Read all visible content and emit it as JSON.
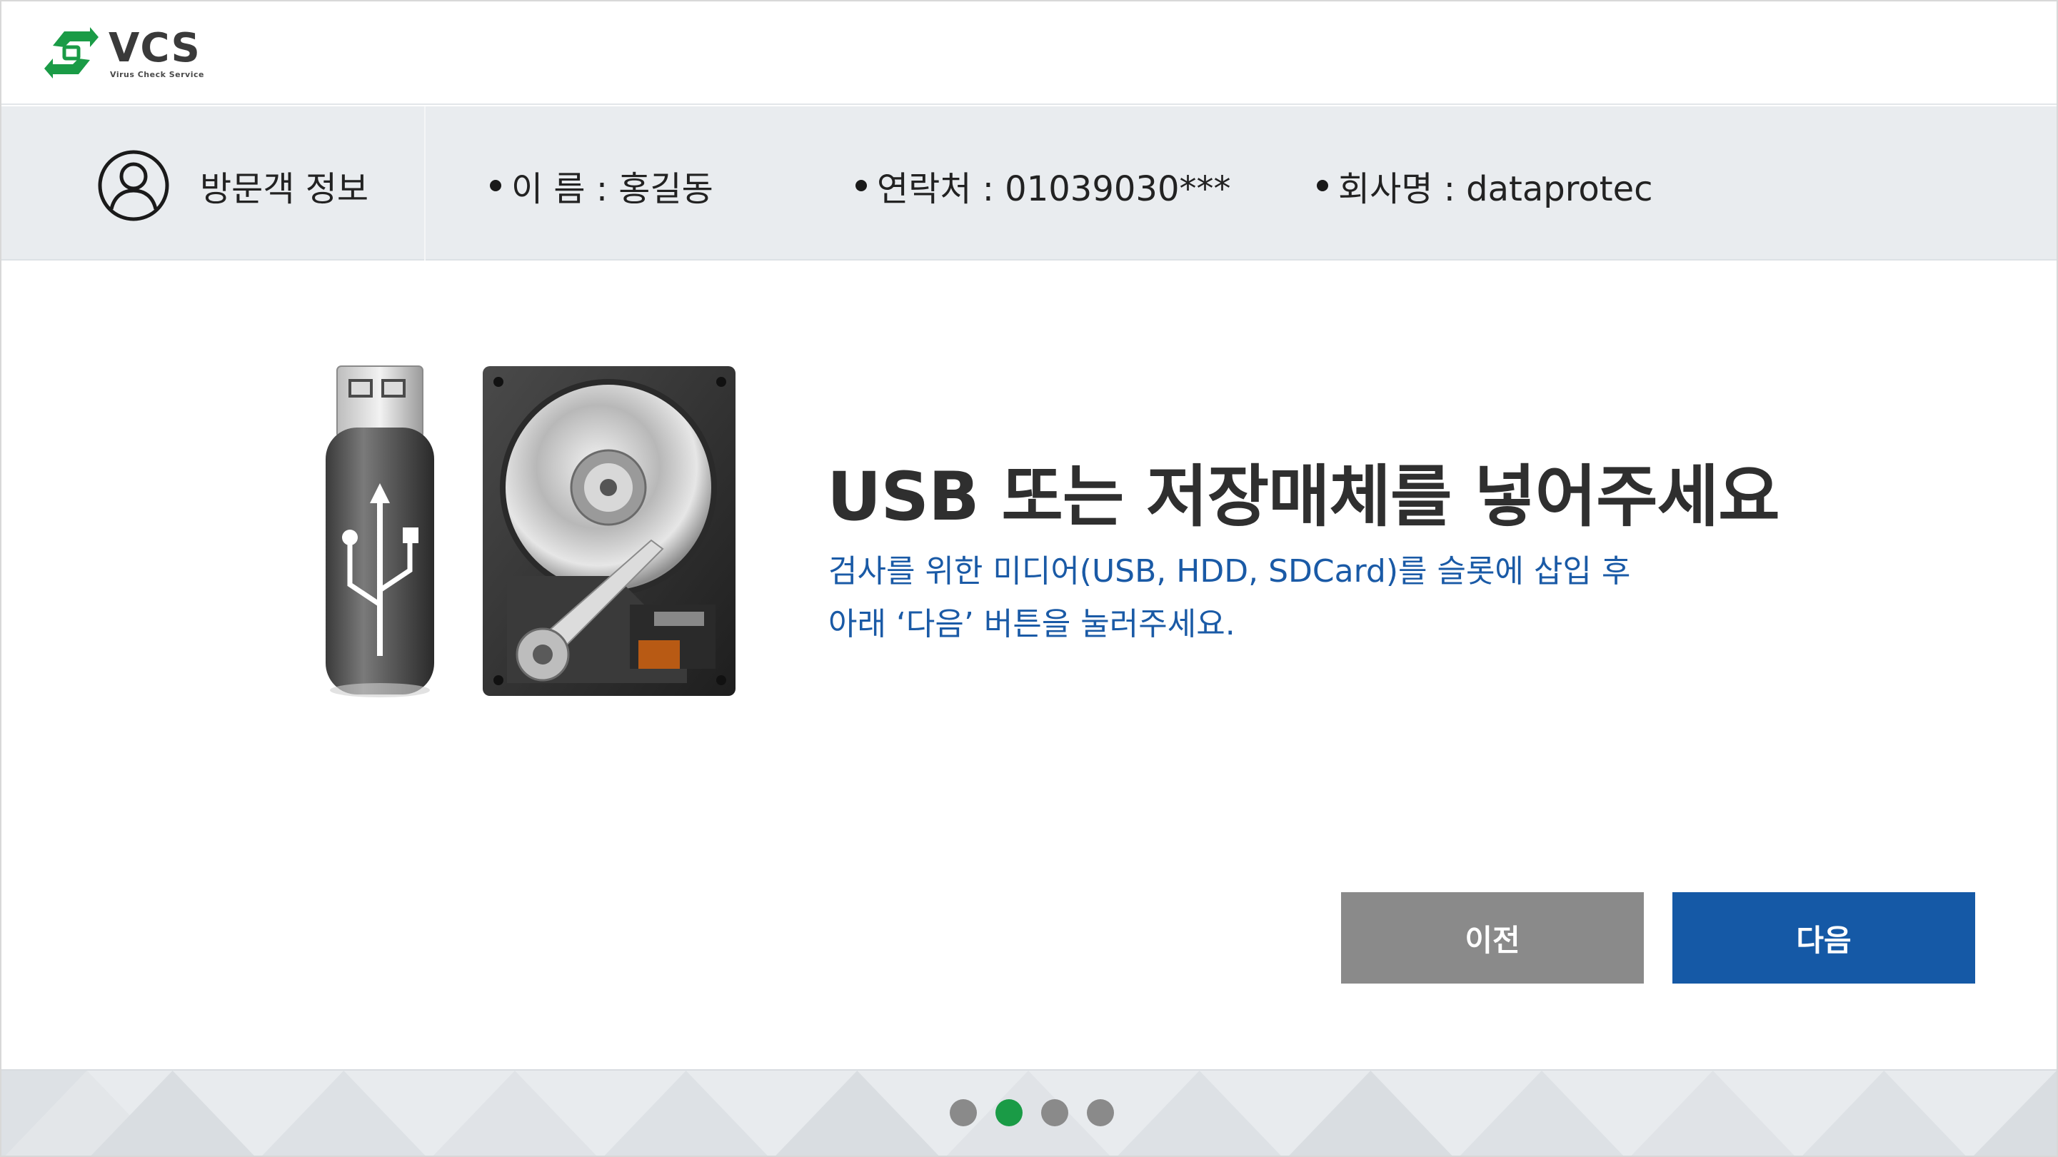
{
  "header": {
    "logo_text": "VCS",
    "logo_subtext": "Virus Check Service"
  },
  "visitor": {
    "title": "방문객 정보",
    "name_label": "이 름 : 홍길동",
    "phone_label": "연락처 : 01039030***",
    "company_label": "회사명 : dataprotec"
  },
  "main": {
    "title": "USB 또는 저장매체를 넣어주세요",
    "desc_line1": "검사를 위한 미디어(USB, HDD, SDCard)를 슬롯에 삽입 후",
    "desc_line2": "아래 ‘다음’ 버튼을 눌러주세요."
  },
  "buttons": {
    "prev_label": "이전",
    "next_label": "다음"
  },
  "pagination": {
    "total": 4,
    "current": 2
  },
  "colors": {
    "primary": "#1559a6",
    "secondary": "#8a8a8a",
    "accent_green": "#1a9b46",
    "desc_text": "#1a5aa6"
  },
  "icons": {
    "logo": "vcs-sync-arrows-logo",
    "user": "user-circle-icon",
    "usb": "usb-drive-icon",
    "hdd": "hard-disk-icon"
  }
}
